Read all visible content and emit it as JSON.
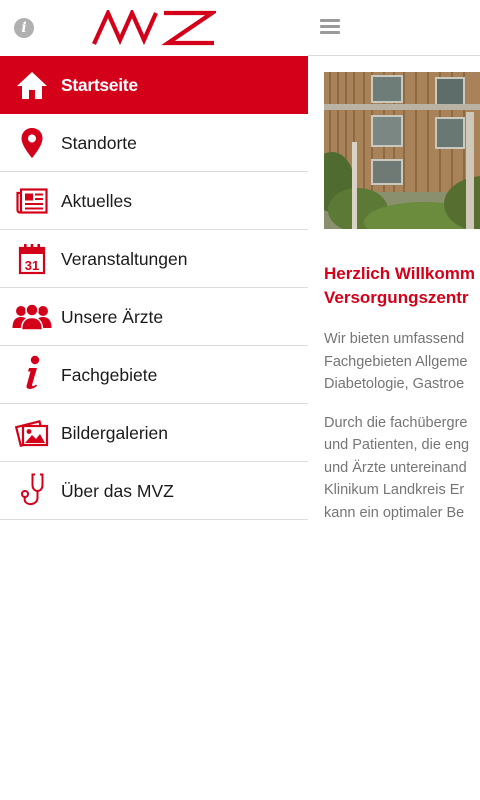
{
  "colors": {
    "accent": "#d4001a",
    "icon_gray": "#b0b0b0",
    "text_gray": "#757575"
  },
  "drawer": {
    "logo_text": "MVZ",
    "info_icon": "info-icon",
    "nav": [
      {
        "label": "Startseite",
        "icon": "home-icon",
        "active": true
      },
      {
        "label": "Standorte",
        "icon": "location-pin-icon",
        "active": false
      },
      {
        "label": "Aktuelles",
        "icon": "newspaper-icon",
        "active": false
      },
      {
        "label": "Veranstaltungen",
        "icon": "calendar-icon",
        "active": false,
        "icon_text": "31"
      },
      {
        "label": "Unsere Ärzte",
        "icon": "people-icon",
        "active": false
      },
      {
        "label": "Fachgebiete",
        "icon": "info-i-icon",
        "active": false
      },
      {
        "label": "Bildergalerien",
        "icon": "photos-icon",
        "active": false
      },
      {
        "label": "Über das MVZ",
        "icon": "stethoscope-icon",
        "active": false
      }
    ]
  },
  "main": {
    "menu_icon": "hamburger-menu-icon",
    "welcome_lines": [
      "Herzlich Willkomm",
      "Versorgungszentr"
    ],
    "paragraph1_lines": [
      "Wir bieten umfassend",
      "Fachgebieten Allgeme",
      "Diabetologie, Gastroe"
    ],
    "paragraph2_lines": [
      "Durch die fachübergre",
      "und Patienten, die eng",
      "und Ärzte untereinand",
      "Klinikum Landkreis Er",
      "kann ein optimaler Be"
    ]
  }
}
